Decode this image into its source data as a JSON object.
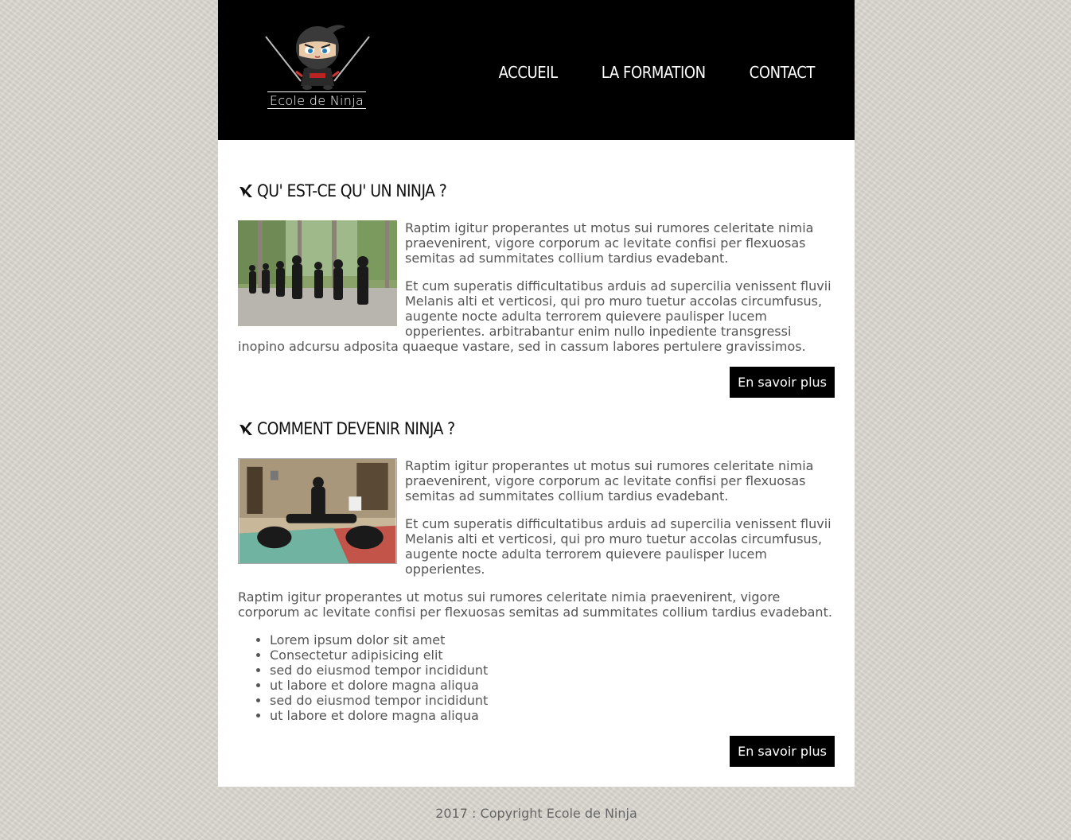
{
  "header": {
    "logo_text": "Ecole de Ninja",
    "nav": [
      "ACCUEIL",
      "LA FORMATION",
      "CONTACT"
    ]
  },
  "sections": [
    {
      "title": "QU' EST-CE QU' UN NINJA ?",
      "paragraphs": [
        "Raptim igitur properantes ut motus sui rumores celeritate nimia praevenirent, vigore corporum ac levitate confisi per flexuosas semitas ad summitates collium tardius evadebant.",
        "Et cum superatis difficultatibus arduis ad supercilia venissent fluvii Melanis alti et verticosi, qui pro muro tuetur accolas circumfusus, augente nocte adulta terrorem quievere paulisper lucem opperientes. arbitrabantur enim nullo inpediente transgressi inopino adcursu adposita quaeque vastare, sed in cassum labores pertulere gravissimos."
      ],
      "button": "En savoir plus"
    },
    {
      "title": "COMMENT DEVENIR NINJA ?",
      "paragraphs": [
        "Raptim igitur properantes ut motus sui rumores celeritate nimia praevenirent, vigore corporum ac levitate confisi per flexuosas semitas ad summitates collium tardius evadebant.",
        "Et cum superatis difficultatibus arduis ad supercilia venissent fluvii Melanis alti et verticosi, qui pro muro tuetur accolas circumfusus, augente nocte adulta terrorem quievere paulisper lucem opperientes.",
        "Raptim igitur properantes ut motus sui rumores celeritate nimia praevenirent, vigore corporum ac levitate confisi per flexuosas semitas ad summitates collium tardius evadebant."
      ],
      "list": [
        "Lorem ipsum dolor sit amet",
        "Consectetur adipisicing elit",
        "sed do eiusmod tempor incididunt",
        "ut labore et dolore magna aliqua",
        "sed do eiusmod tempor incididunt",
        "ut labore et dolore magna aliqua"
      ],
      "button": "En savoir plus"
    }
  ],
  "footer": "2017 : Copyright Ecole de Ninja",
  "colors": {
    "header_bg": "#000000",
    "page_bg": "#d9d6cf",
    "text": "#555555",
    "button_bg": "#000000"
  }
}
